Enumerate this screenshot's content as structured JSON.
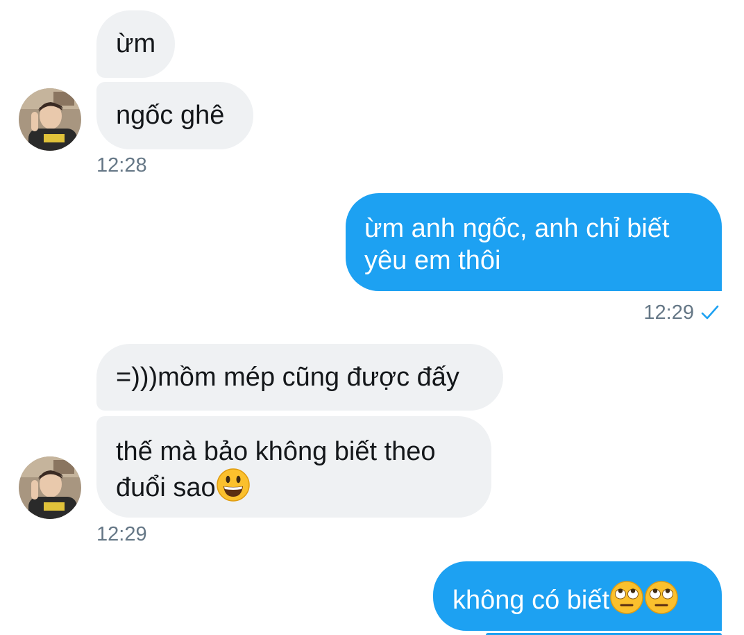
{
  "messages": {
    "in_1": "ừm",
    "in_2": "ngốc ghê",
    "time_1": "12:28",
    "out_1_line1": "ừm anh ngốc, anh chỉ biết",
    "out_1_line2": "yêu em thôi",
    "time_2": "12:29",
    "in_3": "=)))mồm mép cũng được đấy",
    "in_4_line1": "thế mà bảo không biết theo",
    "in_4_line2": "đuổi sao",
    "time_3": "12:29",
    "out_2": "không có biết"
  },
  "icons": {
    "read_receipt": "check-icon",
    "smiley": "grinning-face-emoji",
    "eye_roll": "face-with-rolling-eyes-emoji"
  },
  "colors": {
    "outgoing_bubble": "#1da1f2",
    "incoming_bubble": "#eff1f3",
    "timestamp": "#657786",
    "check": "#1da1f2"
  }
}
